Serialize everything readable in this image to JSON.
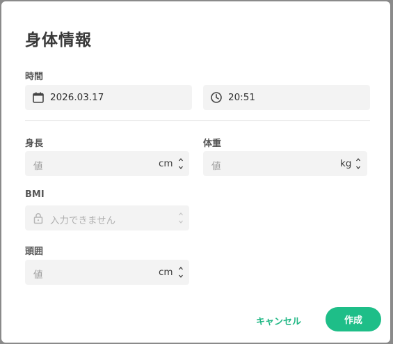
{
  "dialog": {
    "title": "身体情報",
    "time": {
      "label": "時間",
      "date_value": "2026.03.17",
      "time_value": "20:51"
    },
    "height": {
      "label": "身長",
      "placeholder": "値",
      "unit": "cm"
    },
    "weight": {
      "label": "体重",
      "placeholder": "値",
      "unit": "kg"
    },
    "bmi": {
      "label": "BMI",
      "placeholder": "入力できません"
    },
    "head": {
      "label": "頭囲",
      "placeholder": "値",
      "unit": "cm"
    },
    "buttons": {
      "cancel": "キャンセル",
      "create": "作成"
    },
    "colors": {
      "accent": "#1ebe88",
      "field_bg": "#f3f3f3"
    },
    "icons": [
      "calendar-icon",
      "clock-icon",
      "lock-icon",
      "spinner-arrows-icon"
    ]
  }
}
